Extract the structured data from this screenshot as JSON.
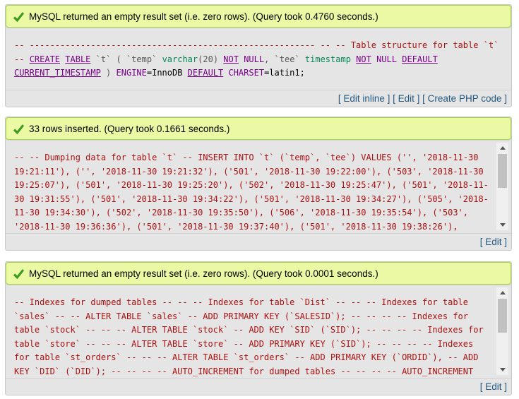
{
  "blocks": [
    {
      "message": "MySQL returned an empty result set (i.e. zero rows). (Query took 0.4760 seconds.)",
      "footer": {
        "edit_inline": "Edit inline",
        "edit": "Edit",
        "create_php": "Create PHP code"
      }
    },
    {
      "message": "33 rows inserted. (Query took 0.1661 seconds.)",
      "footer": {
        "edit": "Edit"
      }
    },
    {
      "message": "MySQL returned an empty result set (i.e. zero rows). (Query took 0.0001 seconds.)",
      "footer": {
        "edit": "Edit"
      }
    }
  ],
  "sql1": {
    "line1": "-- -------------------------------------------------------- -- -- Table structure for table `t`",
    "line2_parts": [
      "-- ",
      "CREATE",
      " ",
      "TABLE",
      " `t` ( `temp` ",
      "varchar",
      "(20) ",
      "NOT",
      " ",
      "NULL",
      ", `tee` ",
      "timestamp",
      " ",
      "NOT",
      " ",
      "NULL",
      " ",
      "DEFAULT"
    ],
    "line3_parts": [
      "CURRENT_TIMESTAMP",
      " ) ",
      "ENGINE",
      "=InnoDB ",
      "DEFAULT",
      " ",
      "CHARSET",
      "=latin1;"
    ]
  },
  "sql2": {
    "lines": [
      "-- -- Dumping data for table `t` -- INSERT INTO `t` (`temp`, `tee`) VALUES ('', '2018-11-30",
      "19:21:11'), ('', '2018-11-30 19:21:32'), ('501', '2018-11-30 19:22:00'), ('503', '2018-11-30",
      "19:25:07'), ('501', '2018-11-30 19:25:20'), ('502', '2018-11-30 19:25:47'), ('501', '2018-11-",
      "30 19:31:55'), ('501', '2018-11-30 19:34:22'), ('501', '2018-11-30 19:34:27'), ('505', '2018-",
      "11-30 19:34:30'), ('502', '2018-11-30 19:35:50'), ('506', '2018-11-30 19:35:54'), ('503',",
      "'2018-11-30 19:36:36'), ('501', '2018-11-30 19:37:40'), ('501', '2018-11-30 19:38:26'),"
    ]
  },
  "sql3": {
    "lines": [
      "-- Indexes for dumped tables -- -- -- Indexes for table `Dist` -- -- -- Indexes for table",
      "`sales` -- -- ALTER TABLE `sales` -- ADD PRIMARY KEY (`SALESID`); -- -- -- -- Indexes for",
      "table `stock` -- -- -- ALTER TABLE `stock` -- ADD KEY `SID` (`SID`); -- -- -- -- Indexes for",
      "table `store` -- -- -- ALTER TABLE `store` -- ADD PRIMARY KEY (`SID`); -- -- -- -- Indexes",
      "for table `st_orders` -- -- -- ALTER TABLE `st_orders` -- ADD PRIMARY KEY (`ORDID`), -- ADD",
      "KEY `DID` (`DID`); -- -- -- -- AUTO_INCREMENT for dumped tables -- -- -- -- AUTO_INCREMENT"
    ]
  },
  "colors": {
    "success_bg": "#ebf8a4",
    "success_border": "#a2d246",
    "link": "#235a81",
    "comment": "#aa1111",
    "keyword": "#770088"
  }
}
